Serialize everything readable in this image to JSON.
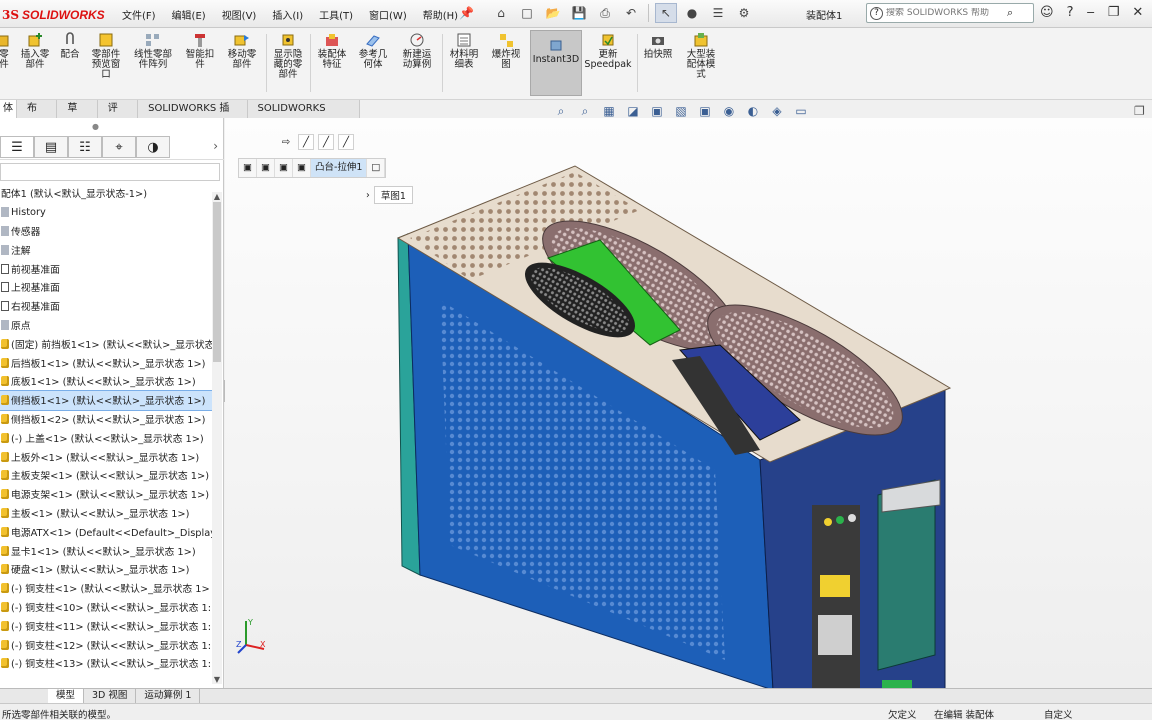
{
  "app": {
    "logo_ds": "3S",
    "logo_sw": "SOLIDWORKS",
    "document_title": "装配体1",
    "colors": {
      "brand": "#d11",
      "selection": "#cce3fb",
      "chassis_blue": "#1d5fb8",
      "accent_green": "#32c232"
    }
  },
  "menu": [
    "文件(F)",
    "编辑(E)",
    "视图(V)",
    "插入(I)",
    "工具(T)",
    "窗口(W)",
    "帮助(H)"
  ],
  "quick_tools": [
    "home-icon",
    "new-icon",
    "open-icon",
    "save-icon",
    "print-icon",
    "undo-icon",
    "select-icon",
    "traffic-light-icon",
    "file-props-icon",
    "options-icon"
  ],
  "search": {
    "placeholder": "搜索 SOLIDWORKS 帮助"
  },
  "window_icons": [
    "user-icon",
    "help-icon",
    "minimize-icon",
    "restore-icon",
    "close-icon"
  ],
  "commands": [
    "零\n件",
    "插入零\n部件",
    "配合",
    "零部件\n预览窗\n口",
    "线性零部\n件阵列",
    "智能扣\n件",
    "移动零\n部件",
    "显示隐\n藏的零\n部件",
    "装配体\n特征",
    "参考几\n何体",
    "新建运\n动算例",
    "材料明\n细表",
    "爆炸视\n图",
    "Instant3D",
    "更新\nSpeedpak",
    "拍快照",
    "大型装\n配体模\n式"
  ],
  "tabs": [
    "体",
    "布局",
    "草图",
    "评估",
    "SOLIDWORKS 插件",
    "SOLIDWORKS MBD"
  ],
  "tree": {
    "root": "配体1 (默认<默认_显示状态-1>)",
    "items": [
      {
        "label": "History",
        "icon": "folder"
      },
      {
        "label": "传感器",
        "icon": "folder"
      },
      {
        "label": "注解",
        "icon": "folder"
      },
      {
        "label": "前视基准面",
        "icon": "plane"
      },
      {
        "label": "上视基准面",
        "icon": "plane"
      },
      {
        "label": "右视基准面",
        "icon": "plane"
      },
      {
        "label": "原点",
        "icon": "folder"
      },
      {
        "label": "(固定) 前挡板1<1> (默认<<默认>_显示状态",
        "icon": "part"
      },
      {
        "label": "后挡板1<1> (默认<<默认>_显示状态 1>)",
        "icon": "part"
      },
      {
        "label": "底板1<1> (默认<<默认>_显示状态 1>)",
        "icon": "part"
      },
      {
        "label": "侧挡板1<1> (默认<<默认>_显示状态 1>)",
        "icon": "part",
        "selected": true
      },
      {
        "label": "侧挡板1<2> (默认<<默认>_显示状态 1>)",
        "icon": "part"
      },
      {
        "label": "(-) 上盖<1> (默认<<默认>_显示状态 1>)",
        "icon": "part"
      },
      {
        "label": "上板外<1> (默认<<默认>_显示状态 1>)",
        "icon": "part"
      },
      {
        "label": "主板支架<1> (默认<<默认>_显示状态 1>)",
        "icon": "part"
      },
      {
        "label": "电源支架<1> (默认<<默认>_显示状态 1>)",
        "icon": "part"
      },
      {
        "label": "主板<1> (默认<<默认>_显示状态 1>)",
        "icon": "part"
      },
      {
        "label": "电源ATX<1> (Default<<Default>_Display",
        "icon": "part"
      },
      {
        "label": "显卡1<1> (默认<<默认>_显示状态 1>)",
        "icon": "part"
      },
      {
        "label": "硬盘<1> (默认<<默认>_显示状态 1>)",
        "icon": "part"
      },
      {
        "label": "(-) 铜支柱<1> (默认<<默认>_显示状态 1>",
        "icon": "part"
      },
      {
        "label": "(-) 铜支柱<10> (默认<<默认>_显示状态 1:",
        "icon": "part"
      },
      {
        "label": "(-) 铜支柱<11> (默认<<默认>_显示状态 1:",
        "icon": "part"
      },
      {
        "label": "(-) 铜支柱<12> (默认<<默认>_显示状态 1:",
        "icon": "part"
      },
      {
        "label": "(-) 铜支柱<13> (默认<<默认>_显示状态 1:",
        "icon": "part"
      }
    ]
  },
  "viewport": {
    "breadcrumb": [
      "凸台-拉伸1"
    ],
    "sketch_label": "草图1"
  },
  "bottom_tabs": [
    "模型",
    "3D 视图",
    "运动算例 1"
  ],
  "status": {
    "message": "所选零部件相关联的模型。",
    "under_defined": "欠定义",
    "editing": "在编辑 装配体",
    "custom": "自定义"
  }
}
